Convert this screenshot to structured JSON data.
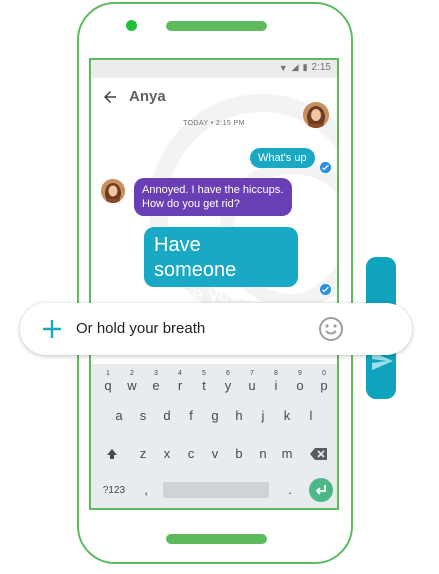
{
  "status_bar": {
    "time": "2:15"
  },
  "header": {
    "back_icon": "arrow-back-icon",
    "title": "Anya",
    "avatar_icon": "contact-avatar"
  },
  "conversation": {
    "day_label": "TODAY • 2:15 PM",
    "messages": [
      {
        "from": "me",
        "text": "What's up"
      },
      {
        "from": "Anya",
        "text": "Annoyed. I have the hiccups. How do you get rid?"
      },
      {
        "from": "me",
        "text": "Have someone scare you"
      }
    ]
  },
  "compose": {
    "plus_icon": "plus-icon",
    "text": "Or hold your breath",
    "emoji_icon": "emoji-icon",
    "send_icon": "send-icon"
  },
  "keyboard": {
    "row1": [
      "q",
      "w",
      "e",
      "r",
      "t",
      "y",
      "u",
      "i",
      "o",
      "p"
    ],
    "row1_hints": [
      "1",
      "2",
      "3",
      "4",
      "5",
      "6",
      "7",
      "8",
      "9",
      "0"
    ],
    "row2": [
      "a",
      "s",
      "d",
      "f",
      "g",
      "h",
      "j",
      "k",
      "l"
    ],
    "row3": [
      "z",
      "x",
      "c",
      "v",
      "b",
      "n",
      "m"
    ],
    "symbols": "?123",
    "comma": ",",
    "period": "."
  },
  "colors": {
    "accent": "#19a9c4",
    "incoming": "#6a3fb5",
    "frame": "#5dbb5e",
    "check": "#2d8fe0"
  }
}
